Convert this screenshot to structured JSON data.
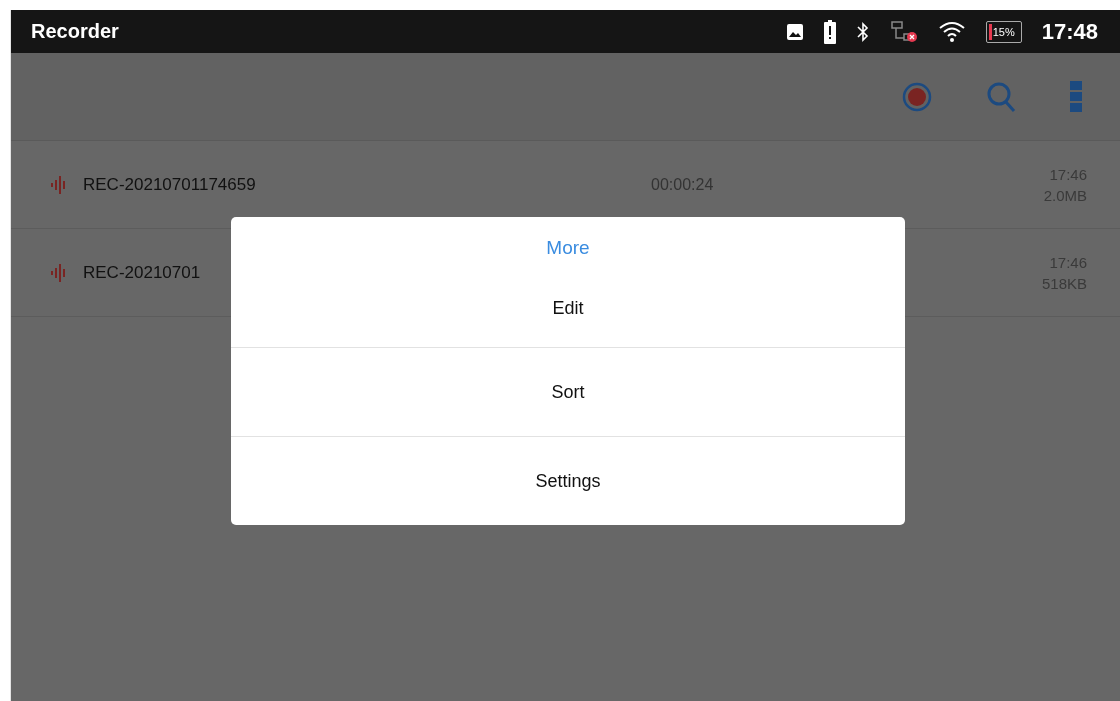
{
  "status_bar": {
    "title": "Recorder",
    "battery_percent": "15%",
    "time": "17:48"
  },
  "recordings": [
    {
      "name": "REC-20210701174659",
      "duration": "00:00:24",
      "time": "17:46",
      "size": "2.0MB"
    },
    {
      "name": "REC-20210701",
      "time": "17:46",
      "size": "518KB"
    }
  ],
  "dialog": {
    "title": "More",
    "items": [
      "Edit",
      "Sort",
      "Settings"
    ]
  }
}
